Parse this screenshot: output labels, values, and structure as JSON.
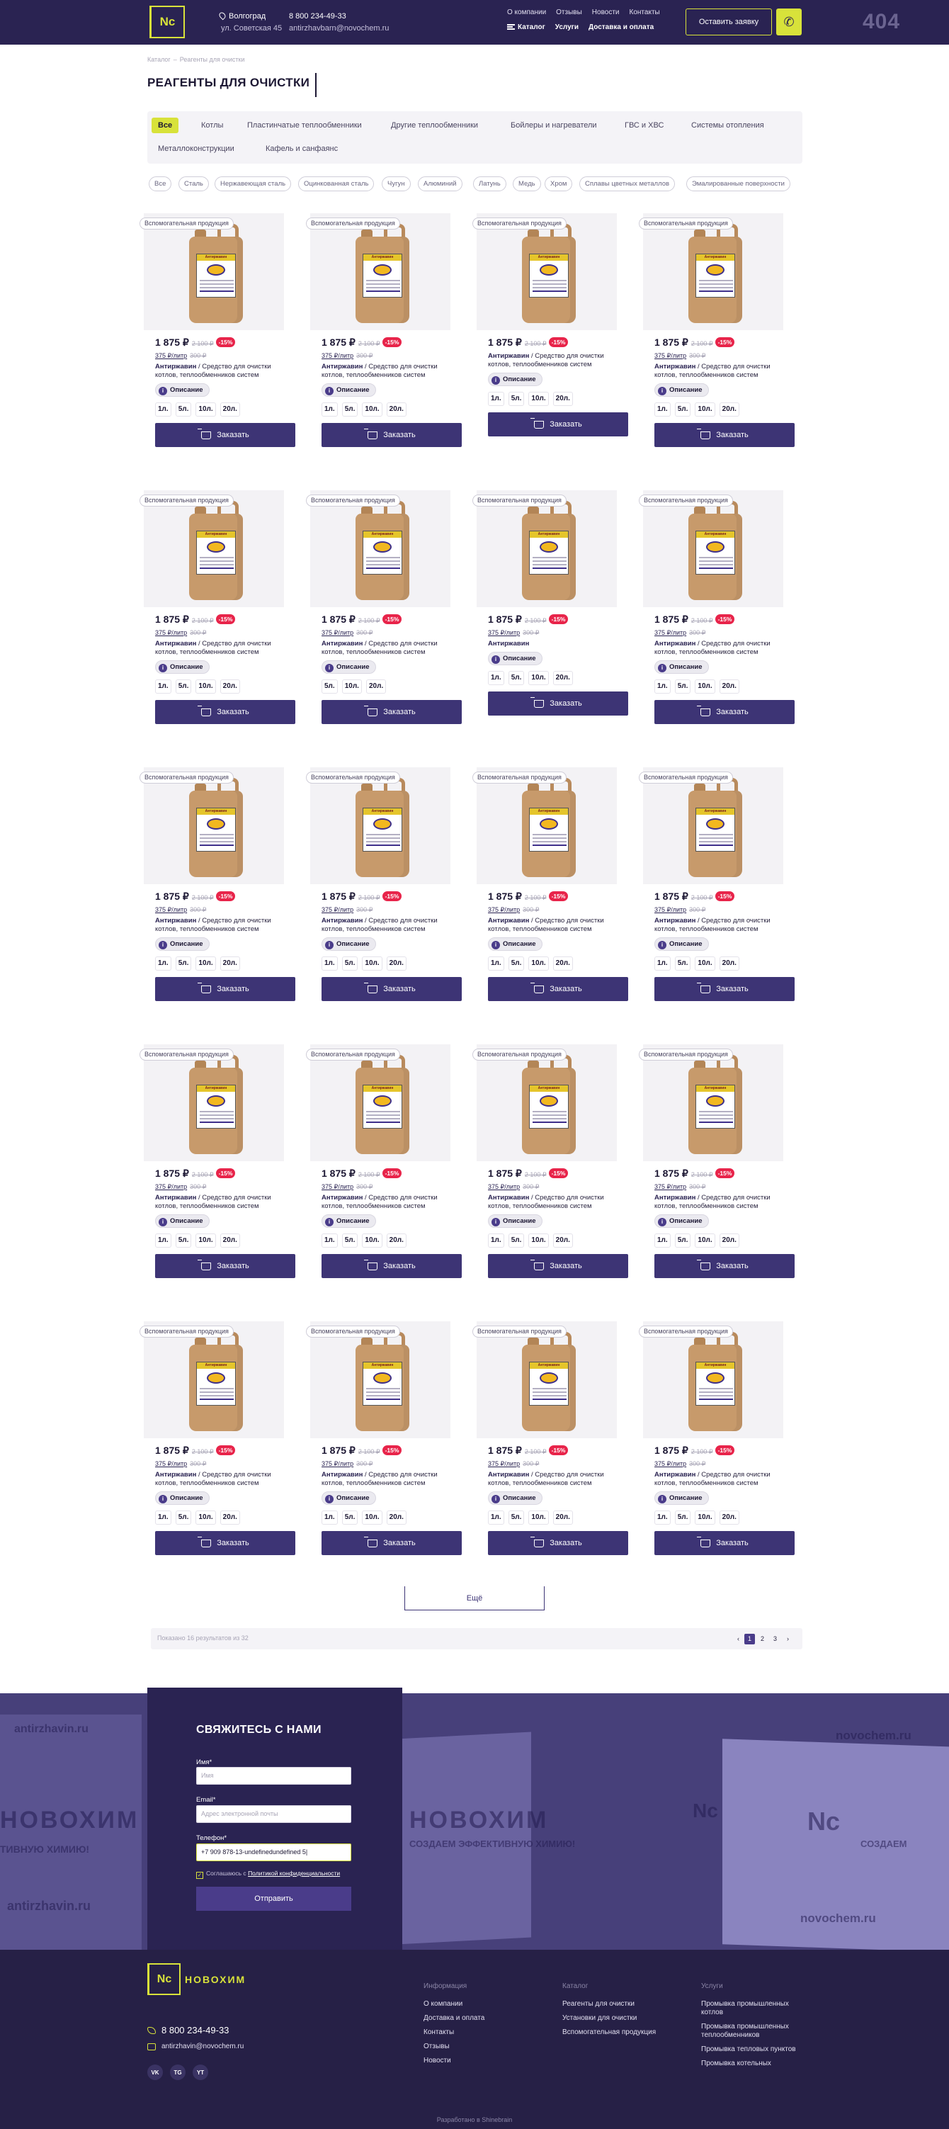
{
  "header": {
    "logo": "Nc",
    "city": "Волгоград",
    "address": "ул. Советская 45",
    "phone": "8 800 234-49-33",
    "email": "antirzhavbarn@novochem.ru",
    "nav_top": [
      "О компании",
      "Отзывы",
      "Новости",
      "Контакты"
    ],
    "nav_bottom": [
      "Каталог",
      "Услуги",
      "Доставка и оплата"
    ],
    "request_button": "Оставить заявку",
    "error_code": "404"
  },
  "breadcrumb": [
    "Каталог",
    "Реагенты для очистки"
  ],
  "page_title": "РЕАГЕНТЫ ДЛЯ ОЧИСТКИ",
  "categories": [
    "Все",
    "Котлы",
    "Пластинчатые теплообменники",
    "Другие теплообменники",
    "Бойлеры и нагреватели",
    "ГВС и ХВС",
    "Системы отопления",
    "Металлоконструкции",
    "Кафель и санфаянс"
  ],
  "materials": [
    "Все",
    "Сталь",
    "Нержавеющая сталь",
    "Оцинкованная сталь",
    "Чугун",
    "Алюминий",
    "Латунь",
    "Медь",
    "Хром",
    "Сплавы цветных металлов",
    "Эмалированные поверхности"
  ],
  "product": {
    "tag": "Вспомогательная продукция",
    "label_brand": "Антиржавин",
    "price": "1 875 ₽",
    "old_price": "2 100 ₽",
    "discount": "-15%",
    "unit_price": "375 ₽/литр",
    "unit_old": "300 ₽",
    "name": "Антиржавин",
    "description": "/ Средство для очистки котлов, теплообменников систем отоплен...",
    "info_button": "Описание",
    "buy_button": "Заказать"
  },
  "products": [
    {
      "short": false,
      "has_discount": true,
      "has_unit": true,
      "vols": [
        "1л.",
        "5л.",
        "10л.",
        "20л."
      ]
    },
    {
      "short": false,
      "has_discount": true,
      "has_unit": true,
      "vols": [
        "1л.",
        "5л.",
        "10л.",
        "20л."
      ]
    },
    {
      "short": false,
      "has_discount": true,
      "has_unit": false,
      "vols": [
        "1л.",
        "5л.",
        "10л.",
        "20л."
      ]
    },
    {
      "short": false,
      "has_discount": true,
      "has_unit": true,
      "vols": [
        "1л.",
        "5л.",
        "10л.",
        "20л."
      ]
    },
    {
      "short": false,
      "has_discount": true,
      "has_unit": true,
      "vols": [
        "1л.",
        "5л.",
        "10л.",
        "20л."
      ]
    },
    {
      "short": false,
      "has_discount": true,
      "has_unit": true,
      "vols": [
        "5л.",
        "10л.",
        "20л."
      ]
    },
    {
      "short": true,
      "has_discount": true,
      "has_unit": true,
      "vols": [
        "1л.",
        "5л.",
        "10л.",
        "20л."
      ]
    },
    {
      "short": false,
      "has_discount": true,
      "has_unit": true,
      "vols": [
        "1л.",
        "5л.",
        "10л.",
        "20л."
      ]
    },
    {
      "short": false,
      "has_discount": true,
      "has_unit": true,
      "vols": [
        "1л.",
        "5л.",
        "10л.",
        "20л."
      ]
    },
    {
      "short": false,
      "has_discount": true,
      "has_unit": true,
      "vols": [
        "1л.",
        "5л.",
        "10л.",
        "20л."
      ]
    },
    {
      "short": false,
      "has_discount": true,
      "has_unit": true,
      "vols": [
        "1л.",
        "5л.",
        "10л.",
        "20л."
      ]
    },
    {
      "short": false,
      "has_discount": true,
      "has_unit": true,
      "vols": [
        "1л.",
        "5л.",
        "10л.",
        "20л."
      ]
    },
    {
      "short": false,
      "has_discount": true,
      "has_unit": true,
      "vols": [
        "1л.",
        "5л.",
        "10л.",
        "20л."
      ]
    },
    {
      "short": false,
      "has_discount": true,
      "has_unit": true,
      "vols": [
        "1л.",
        "5л.",
        "10л.",
        "20л."
      ]
    },
    {
      "short": false,
      "has_discount": true,
      "has_unit": true,
      "vols": [
        "1л.",
        "5л.",
        "10л.",
        "20л."
      ]
    },
    {
      "short": false,
      "has_discount": true,
      "has_unit": true,
      "vols": [
        "1л.",
        "5л.",
        "10л.",
        "20л."
      ]
    },
    {
      "short": false,
      "has_discount": true,
      "has_unit": true,
      "vols": [
        "1л.",
        "5л.",
        "10л.",
        "20л."
      ]
    },
    {
      "short": false,
      "has_discount": true,
      "has_unit": true,
      "vols": [
        "1л.",
        "5л.",
        "10л.",
        "20л."
      ]
    },
    {
      "short": false,
      "has_discount": true,
      "has_unit": true,
      "vols": [
        "1л.",
        "5л.",
        "10л.",
        "20л."
      ]
    },
    {
      "short": false,
      "has_discount": true,
      "has_unit": true,
      "vols": [
        "1л.",
        "5л.",
        "10л.",
        "20л."
      ]
    }
  ],
  "more_button": "Ещё",
  "pagination": {
    "info": "Показано 16 результатов из 32",
    "prev": "‹",
    "pages": [
      "1",
      "2",
      "3"
    ],
    "next": "›",
    "current": "1"
  },
  "contact_form": {
    "title": "СВЯЖИТЕСЬ С НАМИ",
    "name_label": "Имя*",
    "name_placeholder": "Имя",
    "email_label": "Email*",
    "email_placeholder": "Адрес электронной почты",
    "phone_label": "Телефон*",
    "phone_value": "+7 909 878-13-undefinedundefined 5|",
    "agree_text": "Соглашаюсь с",
    "agree_link": "Политикой конфиденциальности",
    "submit": "Отправить"
  },
  "background_text": {
    "a": "antirzhavin.ru",
    "b": "novochem.ru",
    "c": "НОВОХИМ",
    "d": "СОЗДАЕМ ЭФФЕКТИВНУЮ ХИМИЮ!",
    "e": "НОВОХИМ",
    "f": "ТИВНУЮ ХИМИЮ!",
    "g": "antirzhavin.ru",
    "h": "novochem.ru",
    "i": "Nc",
    "j": "Nc",
    "k": "СОЗДАЕМ"
  },
  "footer": {
    "logo": "Nc",
    "brand": "НОВОХИМ",
    "phone": "8 800 234-49-33",
    "email": "antirzhavin@novochem.ru",
    "social": [
      "VK",
      "TG",
      "YT"
    ],
    "col1_title": "Информация",
    "col1": [
      "О компании",
      "Доставка и оплата",
      "Контакты",
      "Отзывы",
      "Новости"
    ],
    "col2_title": "Каталог",
    "col2": [
      "Реагенты для очистки",
      "Установки для очистки",
      "Вспомогательная продукция"
    ],
    "col3_title": "Услуги",
    "col3": [
      "Промывка промышленных котлов",
      "Промывка промышленных теплообменников",
      "Промывка тепловых пунктов",
      "Промывка котельных"
    ],
    "copyright": "Разработано в Shinebrain"
  },
  "colors": {
    "brand_dark": "#2a2352",
    "accent": "#d8e23a",
    "button": "#3d3475",
    "discount": "#e8244a"
  }
}
